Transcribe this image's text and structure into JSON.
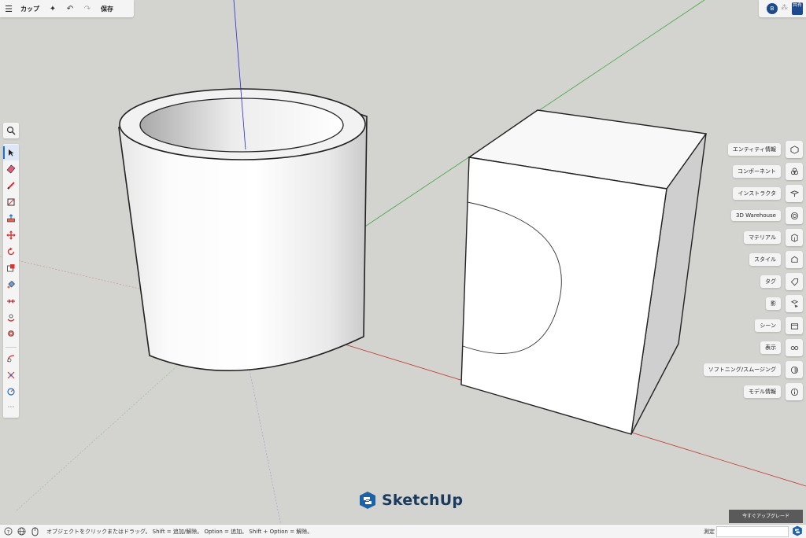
{
  "topbar": {
    "menu_icon": "hamburger-icon",
    "title": "カップ",
    "save_label": "保存"
  },
  "topright": {
    "avatar_initial": "B",
    "share_label": "共有"
  },
  "left_tools": [
    "select-arrow-icon",
    "eraser-icon",
    "pencil-icon",
    "rectangle-icon",
    "push-pull-icon",
    "move-icon",
    "rotate-icon",
    "scale-icon",
    "paint-bucket-icon",
    "section-plane-icon",
    "orbit-icon",
    "position-camera-icon",
    "tape-measure-icon",
    "dimension-icon",
    "protractor-icon"
  ],
  "right_panel": [
    {
      "label": "エンティティ情報",
      "icon": "entity-info-icon"
    },
    {
      "label": "コンポーネント",
      "icon": "components-icon"
    },
    {
      "label": "インストラクタ",
      "icon": "instructor-icon"
    },
    {
      "label": "3D Warehouse",
      "icon": "warehouse-icon"
    },
    {
      "label": "マテリアル",
      "icon": "materials-icon"
    },
    {
      "label": "スタイル",
      "icon": "styles-icon"
    },
    {
      "label": "タグ",
      "icon": "tags-icon"
    },
    {
      "label": "影",
      "icon": "shadows-icon"
    },
    {
      "label": "シーン",
      "icon": "scenes-icon"
    },
    {
      "label": "表示",
      "icon": "display-icon"
    },
    {
      "label": "ソフトニング/スムージング",
      "icon": "soften-icon"
    },
    {
      "label": "モデル情報",
      "icon": "model-info-icon"
    }
  ],
  "upgrade_label": "今すぐアップグレード",
  "logo_text": "SketchUp",
  "status": {
    "message": "オブジェクトをクリックまたはドラッグ。 Shift = 追加/解除。 Option = 追加。 Shift + Option = 解除。",
    "measure_label": "測定",
    "measure_value": ""
  },
  "colors": {
    "accent": "#1d6fd1",
    "axis_red": "#c23a2f",
    "axis_green": "#3fa83f",
    "axis_blue": "#2a2ad0",
    "viewport_bg": "#d3d3cf"
  }
}
